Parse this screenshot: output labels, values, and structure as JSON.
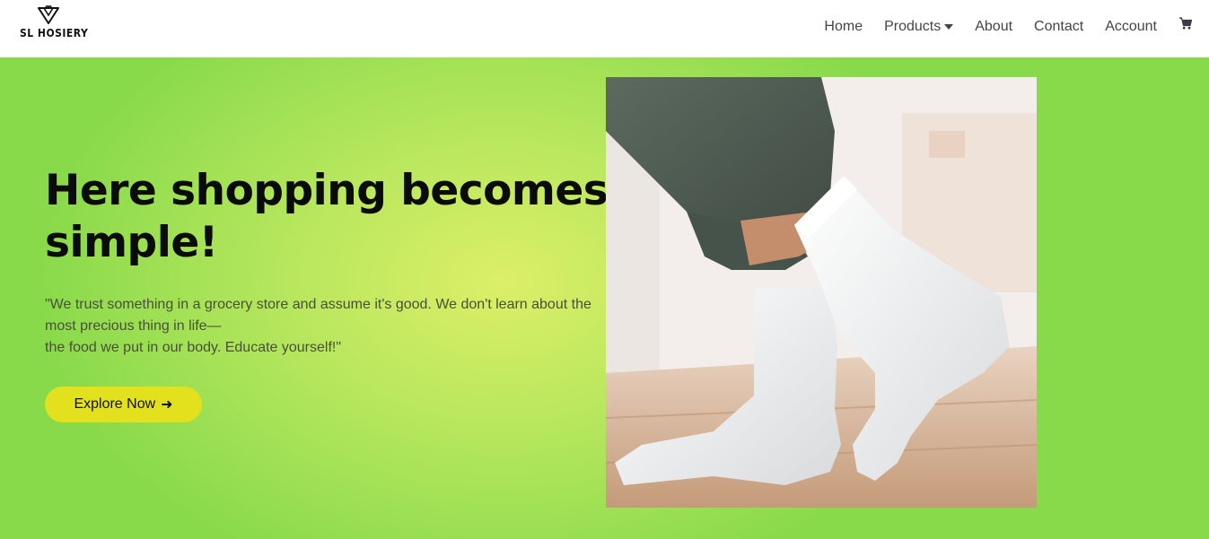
{
  "brand": {
    "name": "SL HOSIERY",
    "logo_icon": "diamond-heart-icon"
  },
  "nav": {
    "items": [
      {
        "label": "Home"
      },
      {
        "label": "Products",
        "icon": "caret-down-icon"
      },
      {
        "label": "About"
      },
      {
        "label": "Contact"
      },
      {
        "label": "Account"
      }
    ],
    "cart_icon": "shopping-cart-icon"
  },
  "hero": {
    "title": "Here shopping becomes simple!",
    "quote_line1": "\"We trust something in a grocery store and assume it's good. We don't learn about the most precious thing in life—",
    "quote_line2": "the food we put in our body. Educate yourself!\"",
    "cta_label": "Explore Now",
    "cta_icon": "arrow-right-icon",
    "image_alt": "feet wearing white crew socks"
  },
  "colors": {
    "hero_bg_center": "#dcef67",
    "hero_bg_edge": "#88da4a",
    "cta_bg": "#e3e11e",
    "nav_text": "#444444"
  }
}
